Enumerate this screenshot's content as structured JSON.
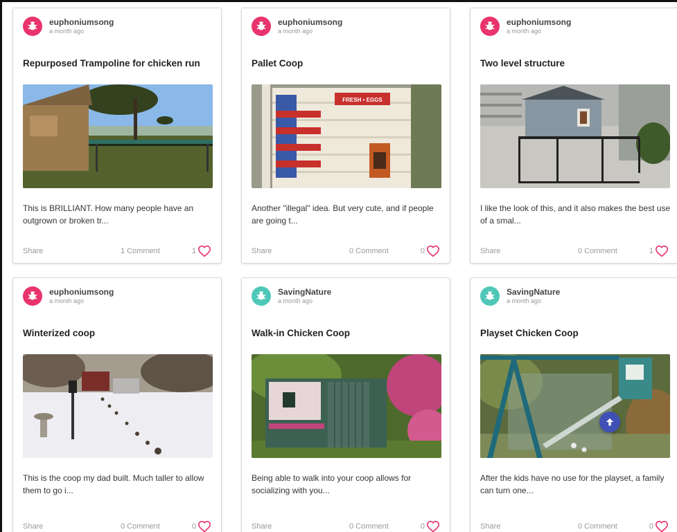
{
  "colors": {
    "pink_avatar": "#e8336d",
    "teal_avatar": "#4fc7b8",
    "heart": "#e8336d",
    "scroll_top": "#3f51b5"
  },
  "posts": [
    {
      "author": "euphoniumsong",
      "time": "a month ago",
      "avatar_color": "pink",
      "title": "Repurposed Trampoline for chicken run",
      "excerpt": "This is BRILLIANT.  How many people have an outgrown or broken tr...",
      "share_label": "Share",
      "comments_label": "1 Comment",
      "likes": "1",
      "image_icon": "trampoline-chicken-run-photo"
    },
    {
      "author": "euphoniumsong",
      "time": "a month ago",
      "avatar_color": "pink",
      "title": "Pallet Coop",
      "excerpt": "Another \"illegal\" idea.  But very cute, and if people are going t...",
      "share_label": "Share",
      "comments_label": "0 Comment",
      "likes": "0",
      "image_icon": "pallet-coop-photo",
      "image_sign": "FRESH • EGGS"
    },
    {
      "author": "euphoniumsong",
      "time": "a month ago",
      "avatar_color": "pink",
      "title": "Two level structure",
      "excerpt": "I like the look of this, and it also makes the best use of a smal...",
      "share_label": "Share",
      "comments_label": "0 Comment",
      "likes": "1",
      "image_icon": "two-level-coop-photo"
    },
    {
      "author": "euphoniumsong",
      "time": "a month ago",
      "avatar_color": "pink",
      "title": "Winterized coop",
      "excerpt": "This is the coop my dad built.  Much taller to allow them to go i...",
      "share_label": "Share",
      "comments_label": "0 Comment",
      "likes": "0",
      "image_icon": "winter-coop-photo"
    },
    {
      "author": "SavingNature",
      "time": "a month ago",
      "avatar_color": "teal",
      "title": "Walk-in Chicken Coop",
      "excerpt": "Being able to walk into your coop allows for socializing with you...",
      "share_label": "Share",
      "comments_label": "0 Comment",
      "likes": "0",
      "image_icon": "walk-in-coop-photo"
    },
    {
      "author": "SavingNature",
      "time": "a month ago",
      "avatar_color": "teal",
      "title": "Playset Chicken Coop",
      "excerpt": "After the kids have no use for the playset, a family can turn one...",
      "share_label": "Share",
      "comments_label": "0 Comment",
      "likes": "0",
      "image_icon": "playset-coop-photo"
    }
  ]
}
